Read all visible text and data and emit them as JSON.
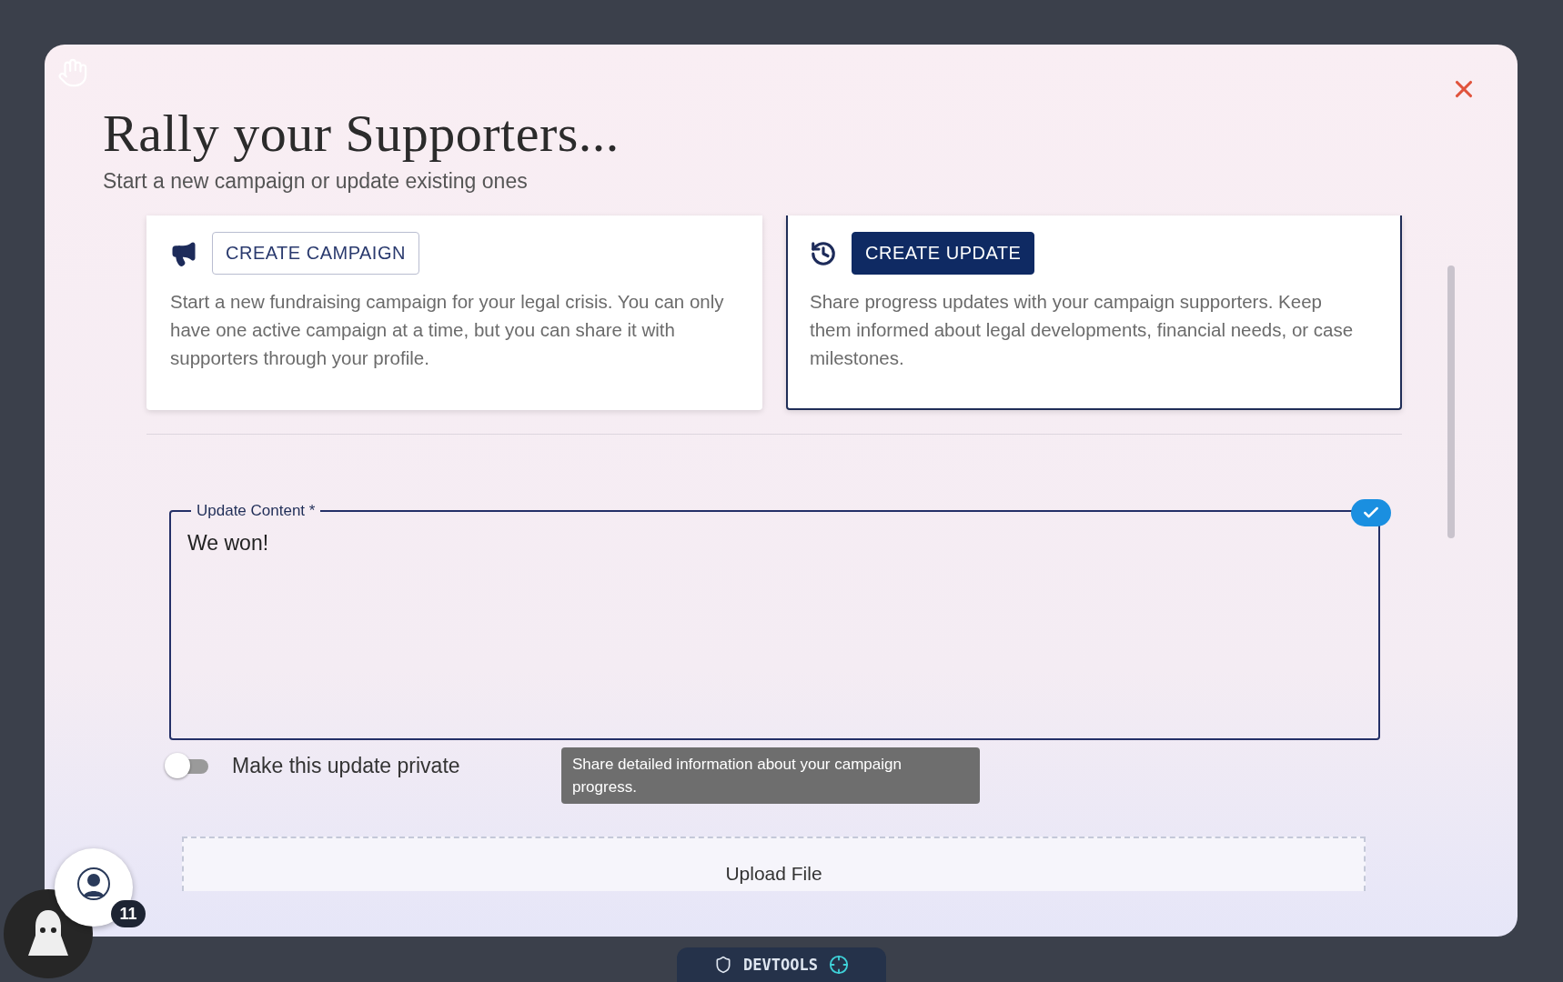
{
  "dialog": {
    "title": "Rally your Supporters...",
    "subtitle": "Start a new campaign or update existing ones"
  },
  "options": [
    {
      "kind": "campaign",
      "button": "CREATE CAMPAIGN",
      "description": "Start a new fundraising campaign for your legal crisis. You can only have one active campaign at a time, but you can share it with supporters through your profile.",
      "selected": false
    },
    {
      "kind": "update",
      "button": "CREATE UPDATE",
      "description": "Share progress updates with your campaign supporters. Keep them informed about legal developments, financial needs, or case milestones.",
      "selected": true
    }
  ],
  "update_form": {
    "label": "Update Content *",
    "value": "We won!",
    "valid": true,
    "private_toggle": {
      "label": "Make this update private",
      "on": false
    },
    "hint": "Share detailed information about your campaign progress.",
    "upload": "Upload File"
  },
  "assistant": {
    "badge": "11"
  },
  "devtools": {
    "label": "DEVTOOLS"
  }
}
